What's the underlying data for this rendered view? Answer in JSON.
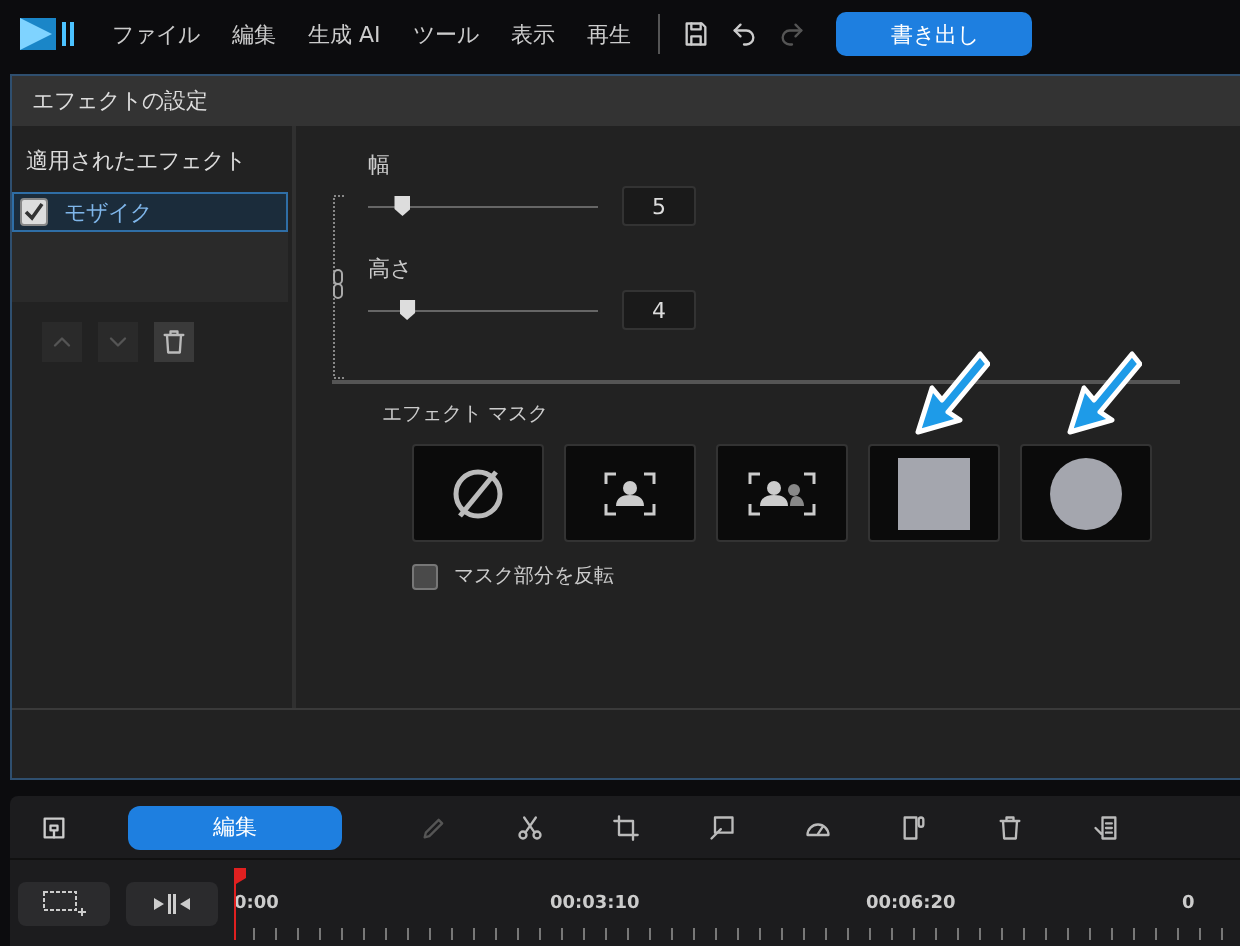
{
  "menu_bar": {
    "items": [
      "ファイル",
      "編集",
      "生成 AI",
      "ツール",
      "表示",
      "再生"
    ],
    "export_button": "書き出し"
  },
  "dialog": {
    "title": "エフェクトの設定",
    "applied_effects": {
      "heading": "適用されたエフェクト",
      "items": [
        {
          "label": "モザイク",
          "checked": true,
          "selected": true
        }
      ]
    },
    "sliders": [
      {
        "label": "幅",
        "level": 0.15,
        "value": "5"
      },
      {
        "label": "高さ",
        "level": 0.17,
        "value": "4"
      }
    ],
    "mask": {
      "heading": "エフェクト マスク",
      "options": [
        {
          "kind": "none",
          "selected": false
        },
        {
          "kind": "person",
          "selected": false
        },
        {
          "kind": "people",
          "selected": false
        },
        {
          "kind": "rectangle",
          "selected": false,
          "annotated": true
        },
        {
          "kind": "circle",
          "selected": false,
          "annotated": true
        }
      ],
      "invert": {
        "label": "マスク部分を反転",
        "checked": false
      }
    }
  },
  "toolbar": {
    "edit_button": "編集"
  },
  "timeline": {
    "ticks": [
      "0:00",
      "00:03:10",
      "00:06:20",
      "0"
    ]
  }
}
